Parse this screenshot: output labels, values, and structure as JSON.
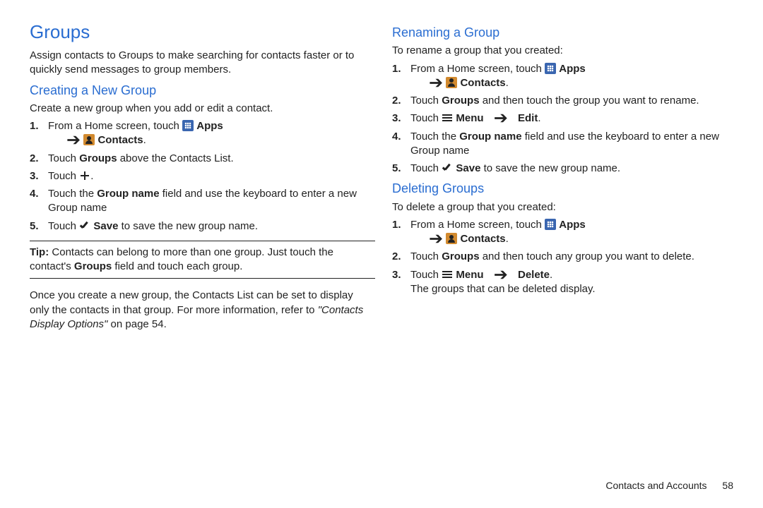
{
  "left": {
    "heading": "Groups",
    "intro": "Assign contacts to Groups to make searching for contacts faster or to quickly send messages to group members.",
    "sub1": "Creating a New Group",
    "sub1Intro": "Create a new group when you add or edit a contact.",
    "step1a": "From a Home screen, touch ",
    "appsLabel": "Apps",
    "contactsLabel": "Contacts",
    "step2": "Touch ",
    "step2b": " above the Contacts List.",
    "groupsWord": "Groups",
    "step3": "Touch ",
    "step4a": "Touch the ",
    "groupNameField": "Group name",
    "step4b": " field and use the keyboard to enter a new Group name",
    "step5a": "Touch ",
    "saveLabel": "Save",
    "step5b": " to save the new group name.",
    "tipLabel": "Tip:",
    "tipText1": "Contacts can belong to more than one group. Just touch the contact's ",
    "tipText2": " field and touch each group.",
    "afterTip1": "Once you create a new group, the Contacts List can be set to display only the contacts in that group. For more information, refer to ",
    "afterTipLink": "\"Contacts Display Options\"",
    "afterTip2": " on page 54."
  },
  "right": {
    "sub1": "Renaming a Group",
    "sub1Intro": "To rename a group that you created:",
    "r2a": "Touch ",
    "r2b": " and then touch the group you want to rename.",
    "r3a": "Touch ",
    "menuLabel": "Menu",
    "editLabel": "Edit",
    "sub2": "Deleting Groups",
    "sub2Intro": "To delete a group that you created:",
    "d2": " and then touch any group you want to delete.",
    "deleteLabel": "Delete",
    "d3b": "The groups that can be deleted display."
  },
  "footer": {
    "chapter": "Contacts and Accounts",
    "page": "58"
  }
}
